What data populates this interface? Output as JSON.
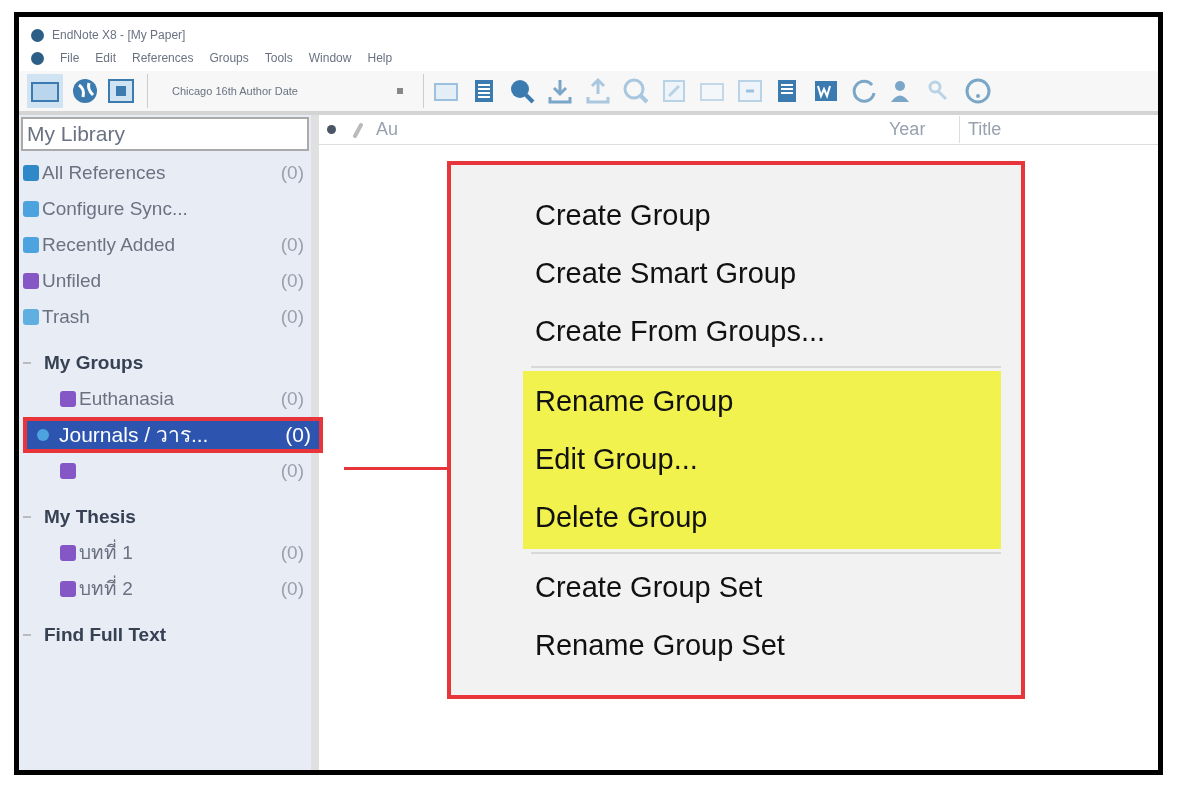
{
  "window": {
    "title": "EndNote X8 - [My Paper]"
  },
  "menu_bar": [
    "File",
    "Edit",
    "References",
    "Groups",
    "Tools",
    "Window",
    "Help"
  ],
  "toolbar": {
    "style_select": "Chicago 16th Author Date"
  },
  "sidebar": {
    "header": "My Library",
    "items": [
      {
        "kind": "item",
        "label": "All References",
        "count": "(0)",
        "selected": false
      },
      {
        "kind": "item",
        "label": "Configure Sync...",
        "selected": false
      },
      {
        "kind": "item",
        "label": "Recently Added",
        "count": "(0)",
        "selected": false
      },
      {
        "kind": "item",
        "label": "Unfiled",
        "count": "(0)",
        "selected": false
      },
      {
        "kind": "item",
        "label": "Trash",
        "count": "(0)",
        "selected": false
      },
      {
        "kind": "group",
        "label": "My Groups",
        "children": [
          {
            "kind": "item",
            "label": "Euthanasia",
            "count": "(0)",
            "selected": false
          },
          {
            "kind": "item",
            "label": "Journals / วาร...",
            "count": "(0)",
            "selected": true
          },
          {
            "kind": "item",
            "count": "(0)",
            "selected": false
          }
        ]
      },
      {
        "kind": "group",
        "label": "My Thesis",
        "children": [
          {
            "kind": "item",
            "label": "บทที่ 1",
            "count": "(0)",
            "selected": false
          },
          {
            "kind": "item",
            "label": "บทที่ 2",
            "count": "(0)",
            "selected": false
          }
        ]
      },
      {
        "kind": "group",
        "label": "Find Full Text"
      }
    ]
  },
  "table": {
    "columns": [
      "Au",
      "Year",
      "Title"
    ]
  },
  "context_menu": {
    "sections": [
      [
        {
          "label": "Create Group",
          "highlighted": false
        },
        {
          "label": "Create Smart Group",
          "highlighted": false
        },
        {
          "label": "Create From Groups...",
          "highlighted": false
        }
      ],
      [
        {
          "label": "Rename Group",
          "highlighted": true
        },
        {
          "label": "Edit Group...",
          "highlighted": true
        },
        {
          "label": "Delete Group",
          "highlighted": true
        }
      ],
      [
        {
          "label": "Create Group Set",
          "highlighted": false
        },
        {
          "label": "Rename Group Set",
          "highlighted": false
        }
      ]
    ]
  }
}
